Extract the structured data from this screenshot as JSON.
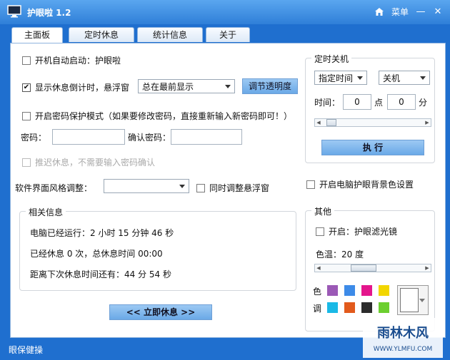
{
  "window": {
    "title": "护眼啦  1.2",
    "menu_label": "菜单"
  },
  "tabs": [
    {
      "label": "主面板",
      "active": true
    },
    {
      "label": "定时休息",
      "active": false
    },
    {
      "label": "统计信息",
      "active": false
    },
    {
      "label": "关于",
      "active": false
    }
  ],
  "main": {
    "autostart_label": "开机自动启动：护眼啦",
    "autostart_checked": false,
    "countdown_label": "显示休息倒计时，悬浮窗",
    "countdown_checked": true,
    "float_mode_value": "总在最前显示",
    "adjust_transparency_label": "调节透明度",
    "password_protect_label": "开启密码保护模式（如果要修改密码，直接重新输入新密码即可！）",
    "password_protect_checked": false,
    "password_label": "密码：",
    "password_value": "",
    "confirm_password_label": "确认密码：",
    "confirm_password_value": "",
    "delay_rest_label": "推迟休息，不需要输入密码确认",
    "delay_rest_checked": false,
    "style_adjust_label": "软件界面风格调整：",
    "style_value": "",
    "sync_float_label": "同时调整悬浮窗",
    "sync_float_checked": false,
    "rest_now_label": "<< 立即休息 >>"
  },
  "related_info": {
    "title": "相关信息",
    "uptime_text": "电脑已经运行：2 小时 15 分钟 46 秒",
    "rest_count_text": "已经休息 0 次，总休息时间 00:00",
    "next_rest_text": "距离下次休息时间还有：44 分 54 秒"
  },
  "shutdown": {
    "title": "定时关机",
    "mode_value": "指定时间",
    "action_value": "关机",
    "time_label": "时间：",
    "hour_value": "0",
    "point_label": "点",
    "minute_value": "0",
    "minute_label": "分",
    "slider_level": 0.05,
    "execute_label": "执 行"
  },
  "bg_color": {
    "label": "开启电脑护眼背景色设置",
    "checked": false
  },
  "other": {
    "title": "其他",
    "filter_label": "开启：护眼滤光镜",
    "filter_checked": false,
    "color_temp_text": "色温：20 度",
    "color_temp_level": 0.38,
    "color_label_1": "色",
    "color_label_2": "调",
    "palette": [
      "#9b59b6",
      "#3d8be8",
      "#e4168c",
      "#f2d600",
      "#1ab9e6",
      "#e25a1c",
      "#2c2c2c",
      "#6ccf2f"
    ],
    "selected_color": "#ffffff"
  },
  "status": {
    "text": "眼保健操"
  },
  "watermark": {
    "brand": "雨林木风",
    "url": "WWW.YLMFU.COM"
  }
}
